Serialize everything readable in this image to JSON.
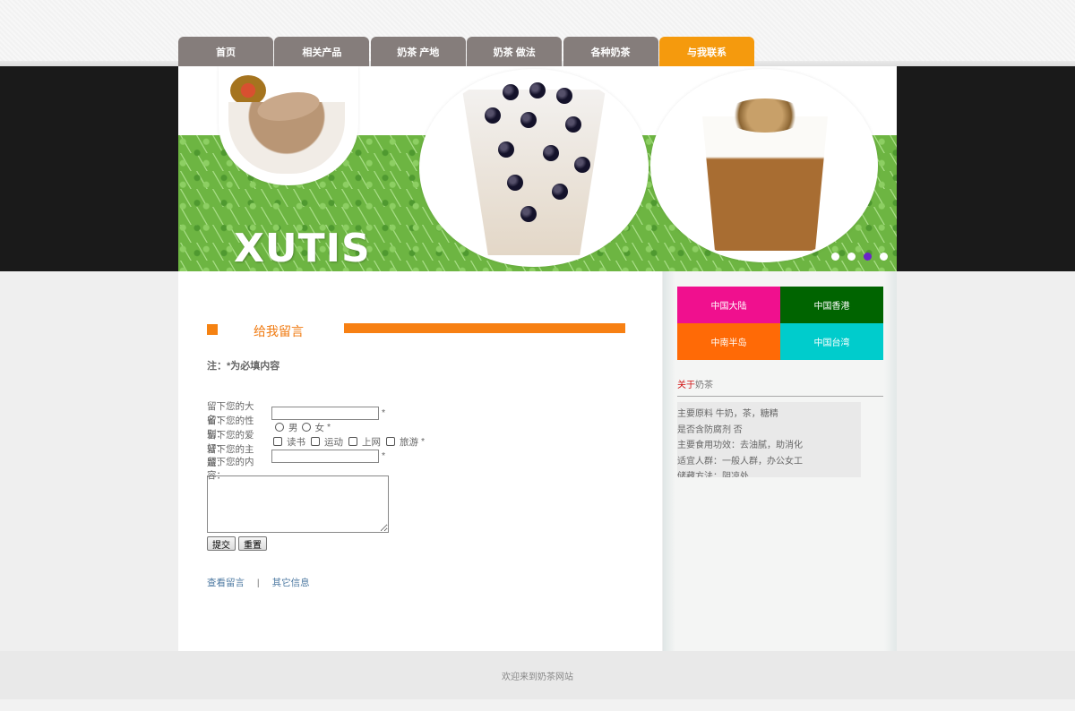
{
  "nav": {
    "items": [
      {
        "label": "首页"
      },
      {
        "label": "相关产品"
      },
      {
        "label": "奶茶 产地"
      },
      {
        "label": "奶茶 做法"
      },
      {
        "label": "各种奶茶"
      },
      {
        "label": "与我联系"
      }
    ],
    "active_index": 5,
    "active_color": "#f59a0d",
    "default_color": "#857d7b"
  },
  "banner": {
    "logo_text": "XUTIS",
    "slide_count": 4,
    "active_slide": 3,
    "active_dot_color": "#6b24c8"
  },
  "message": {
    "title": "给我留言",
    "note": "注：*为必填内容",
    "form": {
      "name_label": "留下您的大名：",
      "gender_label": "留下您的性别：",
      "gender_options": [
        "男",
        "女"
      ],
      "hobby_label": "留下您的爱好：",
      "hobby_options": [
        "读书",
        "运动",
        "上网",
        "旅游"
      ],
      "subject_label": "留下您的主题：",
      "content_label": "留下您的内容：",
      "required_mark": "*",
      "submit_label": "提交",
      "reset_label": "重置"
    },
    "links": {
      "view_messages": "查看留言",
      "separator": "|",
      "other_info": "其它信息"
    }
  },
  "sidebar": {
    "regions": [
      {
        "label": "中国大陆",
        "color": "#f0108e"
      },
      {
        "label": "中国香港",
        "color": "#006400"
      },
      {
        "label": "中南半岛",
        "color": "#ff6a06"
      },
      {
        "label": "中国台湾",
        "color": "#00cccc"
      }
    ],
    "about_title_prefix": "关于",
    "about_title_suffix": "奶茶",
    "about_lines": [
      "主要原料 牛奶，茶，糖精",
      "是否含防腐剂 否",
      "主要食用功效：去油腻，助消化",
      "适宜人群：一般人群，办公女工",
      "储藏方法：阴凉处"
    ]
  },
  "footer": {
    "text": "欢迎来到奶茶网站"
  }
}
